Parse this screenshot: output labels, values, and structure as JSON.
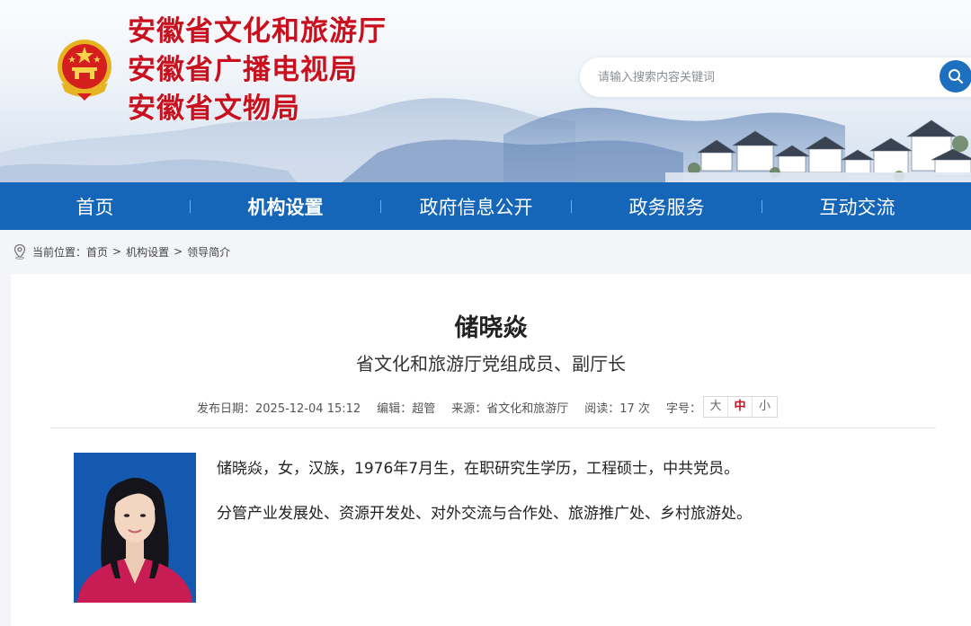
{
  "header": {
    "site_titles": [
      "安徽省文化和旅游厅",
      "安徽省广播电视局",
      "安徽省文物局"
    ],
    "search": {
      "placeholder": "请输入搜索内容关键词"
    },
    "icons": {
      "emblem": "national-emblem",
      "search": "search-icon"
    }
  },
  "nav": {
    "items": [
      {
        "label": "首页",
        "active": false
      },
      {
        "label": "机构设置",
        "active": true
      },
      {
        "label": "政府信息公开",
        "active": false
      },
      {
        "label": "政务服务",
        "active": false
      },
      {
        "label": "互动交流",
        "active": false
      }
    ]
  },
  "breadcrumb": {
    "prefix": "当前位置：",
    "items": [
      "首页",
      "机构设置",
      "领导简介"
    ],
    "separator": ">"
  },
  "article": {
    "name": "储晓焱",
    "position": "省文化和旅游厅党组成员、副厅长",
    "meta": {
      "date_label": "发布日期：",
      "date": "2025-12-04 15:12",
      "editor_label": "编辑：",
      "editor": "超管",
      "source_label": "来源：",
      "source": "省文化和旅游厅",
      "views_label": "阅读：",
      "views": "17 次",
      "fontsize_label": "字号：",
      "fontsize_options": [
        "大",
        "中",
        "小"
      ],
      "fontsize_selected": "中"
    },
    "bio": [
      "储晓焱，女，汉族，1976年7月生，在职研究生学历，工程硕士，中共党员。",
      "分管产业发展处、资源开发处、对外交流与合作处、旅游推广处、乡村旅游处。"
    ]
  },
  "colors": {
    "brand_red": "#c8101e",
    "nav_blue": "#1565b8",
    "search_blue": "#1d6fc0",
    "portrait_bg": "#1458b0"
  }
}
